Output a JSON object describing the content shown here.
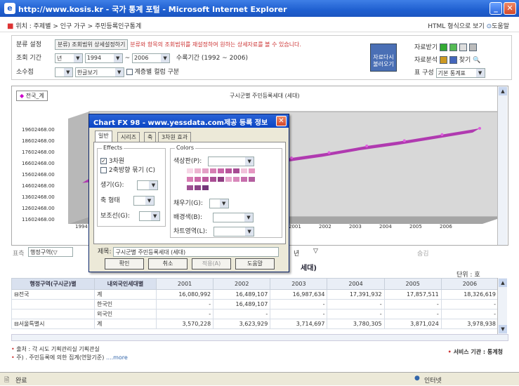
{
  "window": {
    "title": "http://www.kosis.kr - 국가 통계 포털 - Microsoft Internet Explorer"
  },
  "nav": {
    "breadcrumb": "위치 : 주제별 > 인구 가구 > 주민등록인구통계",
    "format_link": "HTML 형식으로 보기",
    "help": "도움말"
  },
  "filter": {
    "category_label": "분류 설정",
    "category_btn": "분류) 조회범위 상세설정하기",
    "category_note": "분류와 항목의 조회범위를 재설정하여 원하는 상세자료를 볼 수 있습니다.",
    "period_label": "조회 기간",
    "period_type": "년",
    "period_from": "1994",
    "period_sep": "~",
    "period_to": "2006",
    "period_note": "수록기간 (1992 ~ 2006)",
    "decimal_label": "소수점",
    "lang_select": "한글보기",
    "checkbox_label": "계층별 컬럼 구분"
  },
  "reload_btn": "자료다시 불러오기",
  "right_tools": {
    "download": "자료받기",
    "analysis": "자료분석",
    "search": "찾기",
    "table_layout_label": "표 구성",
    "table_layout_value": "기본 통계표"
  },
  "chart": {
    "legend": "전국_계",
    "title": "구시군별 주민등록세대 (세대)",
    "y_ticks": [
      "19602468.00",
      "18602468.00",
      "17602468.00",
      "16602468.00",
      "15602468.00",
      "14602468.00",
      "13602468.00",
      "12602468.00",
      "11602468.00"
    ],
    "x_ticks_left": "1994",
    "x_ticks_right": [
      "2001",
      "2002",
      "2003",
      "2004",
      "2005",
      "2006"
    ]
  },
  "chart_data": {
    "type": "line",
    "title": "구시군별 주민등록세대 (세대)",
    "legend": [
      "전국_계"
    ],
    "categories": [
      "2001",
      "2002",
      "2003",
      "2004",
      "2005",
      "2006"
    ],
    "series": [
      {
        "name": "전국_계",
        "values": [
          16080992,
          16489107,
          16987634,
          17391932,
          17857511,
          18326619
        ]
      }
    ]
  },
  "below_chart": {
    "left": "표측",
    "dim_select": "행정구역(▽",
    "sel": "년",
    "right": "숨김"
  },
  "table_title": "세대)",
  "unit": "단위 : 호",
  "table": {
    "h1": "행정구역(구시군)별",
    "h2": "내외국인세대별",
    "years": [
      "2001",
      "2002",
      "2003",
      "2004",
      "2005",
      "2006"
    ],
    "rows": [
      {
        "region": "⊟전국",
        "type": "계",
        "v": [
          "16,080,992",
          "16,489,107",
          "16,987,634",
          "17,391,932",
          "17,857,511",
          "18,326,619"
        ]
      },
      {
        "region": "",
        "type": "한국인",
        "v": [
          "-",
          "16,489,107",
          "-",
          "-",
          "-",
          "-"
        ]
      },
      {
        "region": "",
        "type": "외국인",
        "v": [
          "-",
          "-",
          "-",
          "-",
          "-",
          "-"
        ]
      },
      {
        "region": "⊟서울특별시",
        "type": "계",
        "v": [
          "3,570,228",
          "3,623,929",
          "3,714,697",
          "3,780,305",
          "3,871,024",
          "3,978,938"
        ]
      }
    ]
  },
  "footer": {
    "source": "출처 : 각 시도 기획관리실 기획관실",
    "note": "주) . 주민등록에 의한 집계(연말기준)",
    "more": "....more",
    "service": "서비스 기관 : 통계청"
  },
  "status": {
    "left": "완료",
    "right": "인터넷"
  },
  "dialog": {
    "title": "Chart FX 98 - www.yessdata.com제공 등록 정보",
    "tabs": [
      "일반",
      "시리즈",
      "축",
      "3차원 효과"
    ],
    "effects": "Effects",
    "chk_3d": "3차원",
    "chk_2axis": "2축방향 묶기 (C)",
    "shape": "생기(G):",
    "axis_shape": "축 형태",
    "aux_line": "보조선(G):",
    "colors": "Colors",
    "color_label": "색상판(P):",
    "fill": "채우기(G):",
    "bg": "배경색(B):",
    "chart_area": "차트영역(L):",
    "title_label": "제목:",
    "title_value": "구시군별 주민등록세대 (세대)",
    "ok": "확인",
    "cancel": "취소",
    "apply": "적용(A)",
    "helpbtn": "도움말"
  }
}
